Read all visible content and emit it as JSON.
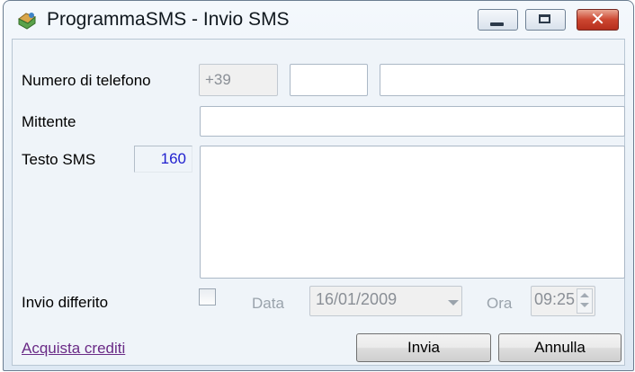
{
  "window": {
    "title": "ProgrammaSMS - Invio SMS"
  },
  "form": {
    "phone": {
      "label": "Numero di telefono",
      "prefix": "+39",
      "area": "",
      "number": ""
    },
    "sender": {
      "label": "Mittente",
      "value": ""
    },
    "text": {
      "label": "Testo SMS",
      "counter": "160",
      "value": ""
    },
    "deferred": {
      "label": "Invio differito",
      "checked": false,
      "date_label": "Data",
      "date_value": "16/01/2009",
      "time_label": "Ora",
      "time_value": "09:25"
    }
  },
  "footer": {
    "buy_credits_link": "Acquista crediti",
    "send_button": "Invia",
    "cancel_button": "Annulla"
  },
  "icons": {
    "app": "sms-envelope-icon",
    "minimize": "minimize-icon",
    "maximize": "maximize-icon",
    "close": "close-icon",
    "dropdown": "chevron-down-icon",
    "spinner": "spinner-arrows-icon"
  },
  "colors": {
    "counter": "#1f1fcf",
    "link": "#6a2a86",
    "close_button": "#cc4630"
  }
}
